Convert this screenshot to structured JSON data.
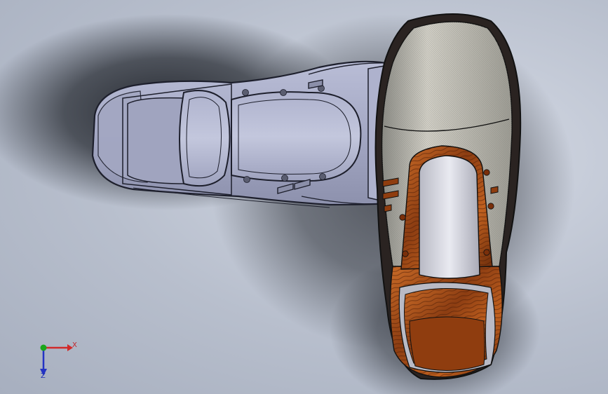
{
  "viewport": {
    "background_color": "#b8bfcd",
    "shadow_color": "#2a2e35"
  },
  "models": [
    {
      "name": "shoe-gray",
      "material": "gray-shaded",
      "color": "#9ea3c0"
    },
    {
      "name": "shoe-wood",
      "material": "wood-textured",
      "color": "#b5561b",
      "upper_color": "#c9c6bd"
    }
  ],
  "triad": {
    "x_label": "X",
    "z_label": "Z",
    "x_color": "#d12a2a",
    "y_color": "#19a61b",
    "z_color": "#2433c4"
  }
}
